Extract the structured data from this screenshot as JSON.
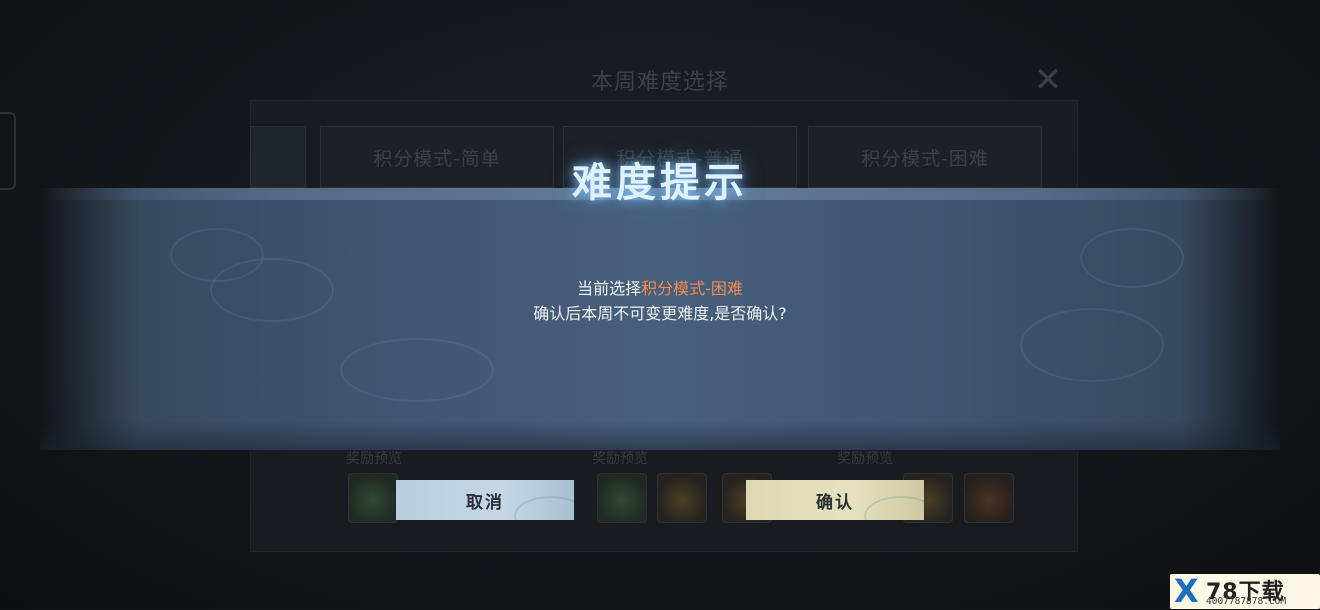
{
  "background_screen": {
    "title": "本周难度选择",
    "close_icon": "close-icon",
    "tabs": [
      {
        "label": "积分模式-简单"
      },
      {
        "label": "积分模式-普通"
      },
      {
        "label": "积分模式-困难"
      }
    ],
    "preview_label": "奖励预览"
  },
  "dialog": {
    "title": "难度提示",
    "message_prefix": "当前选择",
    "message_highlight": "积分模式-困难",
    "message_line2": "确认后本周不可变更难度,是否确认?",
    "highlight_color": "#f08a4f",
    "cancel_label": "取消",
    "confirm_label": "确认"
  },
  "watermark": {
    "logo": "X",
    "brand": "78下载",
    "phone": "4007787878.COM"
  }
}
